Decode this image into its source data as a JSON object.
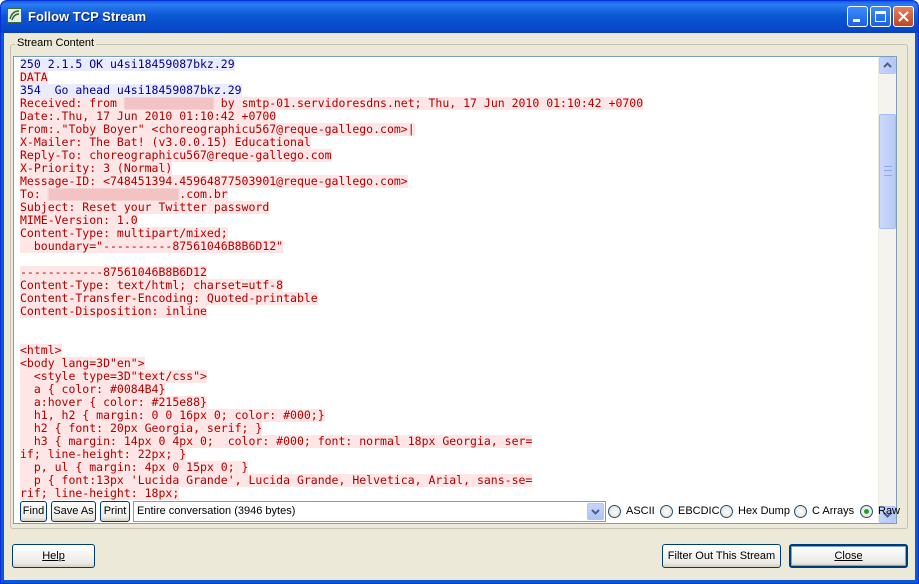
{
  "window": {
    "title": "Follow TCP Stream"
  },
  "group": {
    "label": "Stream Content"
  },
  "stream_lines": [
    {
      "text": "250 2.1.5 OK u4si18459087bkz.29",
      "dir": "server"
    },
    {
      "text": "DATA",
      "dir": "client"
    },
    {
      "text": "354  Go ahead u4si18459087bkz.29",
      "dir": "server"
    },
    {
      "text": "Received: from ",
      "blur": "xxx.xx.xx.xxx",
      "rest": " by smtp-01.servidoresdns.net; Thu, 17 Jun 2010 01:10:42 +0700",
      "dir": "client"
    },
    {
      "text": "Date:.Thu, 17 Jun 2010 01:10:42 +0700",
      "dir": "client"
    },
    {
      "text": "From:.\"Toby Boyer\" <choreographicu567@reque-gallego.com>|",
      "dir": "client"
    },
    {
      "text": "X-Mailer: The Bat! (v3.0.0.15) Educational",
      "dir": "client"
    },
    {
      "text": "Reply-To: choreographicu567@reque-gallego.com",
      "dir": "client"
    },
    {
      "text": "X-Priority: 3 (Normal)",
      "dir": "client"
    },
    {
      "text": "Message-ID: <748451394.45964877503901@reque-gallego.com>",
      "dir": "client"
    },
    {
      "text": "To: ",
      "blur": "xxxxxxxxxxxxxxxxxxx",
      "rest": ".com.br",
      "dir": "client"
    },
    {
      "text": "Subject: Reset your Twitter password",
      "dir": "client"
    },
    {
      "text": "MIME-Version: 1.0",
      "dir": "client"
    },
    {
      "text": "Content-Type: multipart/mixed;",
      "dir": "client"
    },
    {
      "text": "  boundary=\"----------87561046B8B6D12\"",
      "dir": "client"
    },
    {
      "text": "",
      "dir": "client"
    },
    {
      "text": "------------87561046B8B6D12",
      "dir": "client"
    },
    {
      "text": "Content-Type: text/html; charset=utf-8",
      "dir": "client"
    },
    {
      "text": "Content-Transfer-Encoding: Quoted-printable",
      "dir": "client"
    },
    {
      "text": "Content-Disposition: inline",
      "dir": "client"
    },
    {
      "text": "",
      "dir": "client"
    },
    {
      "text": "",
      "dir": "client"
    },
    {
      "text": "<html>",
      "dir": "client"
    },
    {
      "text": "<body lang=3D\"en\">",
      "dir": "client"
    },
    {
      "text": "  <style type=3D\"text/css\">",
      "dir": "client"
    },
    {
      "text": "  a { color: #0084B4}",
      "dir": "client"
    },
    {
      "text": "  a:hover { color: #215e88}",
      "dir": "client"
    },
    {
      "text": "  h1, h2 { margin: 0 0 16px 0; color: #000;}",
      "dir": "client"
    },
    {
      "text": "  h2 { font: 20px Georgia, serif; }",
      "dir": "client"
    },
    {
      "text": "  h3 { margin: 14px 0 4px 0;  color: #000; font: normal 18px Georgia, ser=",
      "dir": "client"
    },
    {
      "text": "if; line-height: 22px; }",
      "dir": "client"
    },
    {
      "text": "  p, ul { margin: 4px 0 15px 0; }",
      "dir": "client"
    },
    {
      "text": "  p { font:13px 'Lucida Grande', Lucida Grande, Helvetica, Arial, sans-se=",
      "dir": "client"
    },
    {
      "text": "rif; line-height: 18px;",
      "dir": "client"
    }
  ],
  "buttons": {
    "find": "Find",
    "save_as": "Save As",
    "print": "Print",
    "help": "Help",
    "filter": "Filter Out This Stream",
    "close": "Close"
  },
  "conversation": {
    "selected": "Entire conversation (3946 bytes)"
  },
  "formats": [
    {
      "label": "ASCII",
      "selected": false
    },
    {
      "label": "EBCDIC",
      "selected": false
    },
    {
      "label": "Hex Dump",
      "selected": false
    },
    {
      "label": "C Arrays",
      "selected": false
    },
    {
      "label": "Raw",
      "selected": true
    }
  ],
  "colors": {
    "server_text": "#00008a",
    "client_text": "#b00000",
    "accent": "#0a58d6"
  }
}
